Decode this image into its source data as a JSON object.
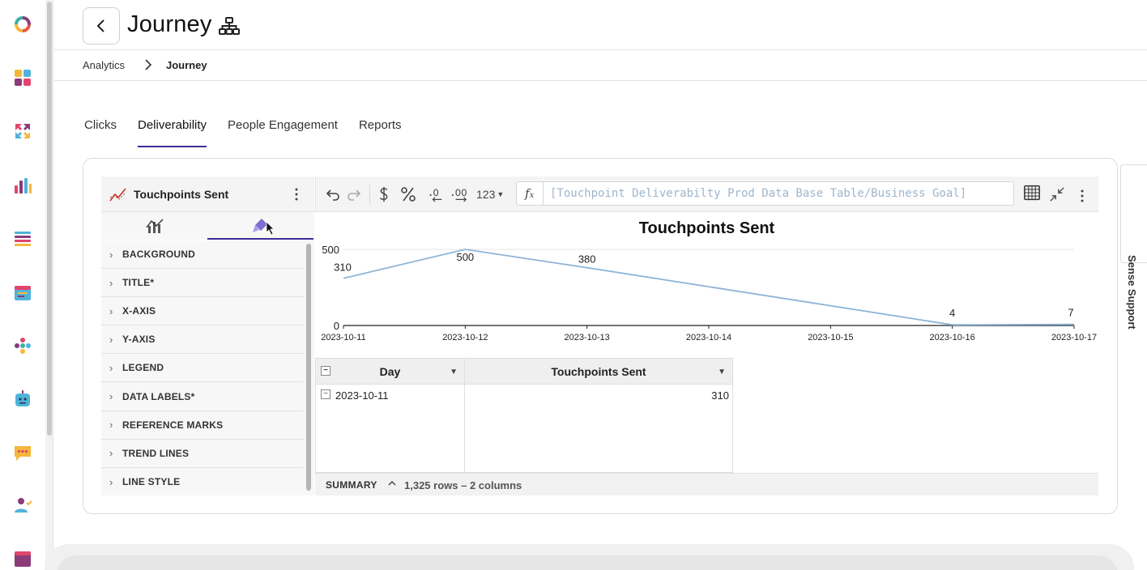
{
  "header": {
    "title": "Journey"
  },
  "breadcrumb": {
    "items": [
      "Analytics",
      "Journey"
    ]
  },
  "tabs": [
    {
      "label": "Clicks"
    },
    {
      "label": "Deliverability"
    },
    {
      "label": "People Engagement"
    },
    {
      "label": "Reports"
    }
  ],
  "active_tab": "Deliverability",
  "panel": {
    "title": "Touchpoints Sent",
    "sections": [
      "BACKGROUND",
      "TITLE*",
      "X-AXIS",
      "Y-AXIS",
      "LEGEND",
      "DATA LABELS*",
      "REFERENCE MARKS",
      "TREND LINES",
      "LINE STYLE"
    ]
  },
  "toolbar": {
    "number_format": "123",
    "formula": "[Touchpoint Deliverabilty Prod Data Base Table/Business Goal]"
  },
  "chart_data": {
    "type": "line",
    "title": "Touchpoints Sent",
    "x": [
      "2023-10-11",
      "2023-10-12",
      "2023-10-13",
      "2023-10-14",
      "2023-10-15",
      "2023-10-16",
      "2023-10-17"
    ],
    "data_labels": [
      {
        "x": "2023-10-11",
        "y": 310,
        "label": "310"
      },
      {
        "x": "2023-10-12",
        "y": 500,
        "label": "500"
      },
      {
        "x": "2023-10-13",
        "y": 380,
        "label": "380"
      },
      {
        "x": "2023-10-16",
        "y": 4,
        "label": "4"
      },
      {
        "x": "2023-10-17",
        "y": 7,
        "label": "7"
      }
    ],
    "series": [
      {
        "values": [
          310,
          500,
          380,
          255,
          130,
          4,
          7
        ]
      }
    ],
    "yticks": [
      "0",
      "500"
    ],
    "ylim": [
      0,
      500
    ],
    "line_color": "#8eb4d6"
  },
  "table": {
    "columns": [
      "Day",
      "Touchpoints Sent"
    ],
    "rows": [
      {
        "day": "2023-10-11",
        "value": "310"
      }
    ]
  },
  "summary": {
    "label": "SUMMARY",
    "info": "1,325 rows – 2 columns"
  },
  "sense_support": {
    "label": "Sense Support"
  }
}
